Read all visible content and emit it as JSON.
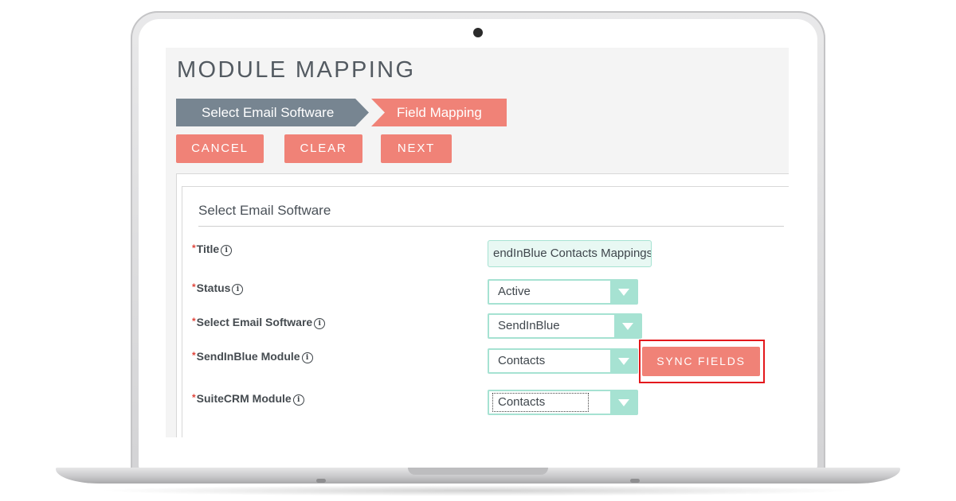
{
  "page": {
    "title": "MODULE MAPPING"
  },
  "wizard": {
    "steps": [
      {
        "label": "Select Email Software"
      },
      {
        "label": "Field Mapping"
      }
    ]
  },
  "actions": {
    "cancel": "CANCEL",
    "clear": "CLEAR",
    "next": "NEXT"
  },
  "form": {
    "heading": "Select Email Software",
    "required_marker": "*",
    "info_glyph": "i",
    "fields": {
      "title": {
        "label": "Title",
        "value": "endInBlue Contacts Mappings"
      },
      "status": {
        "label": "Status",
        "value": "Active"
      },
      "email_software": {
        "label": "Select Email Software",
        "value": "SendInBlue"
      },
      "sendinblue_module": {
        "label": "SendInBlue Module",
        "value": "Contacts"
      },
      "suitecrm_module": {
        "label": "SuiteCRM Module",
        "value": "Contacts"
      }
    },
    "sync_button": "SYNC FIELDS"
  },
  "colors": {
    "accent": "#f08277",
    "step_inactive": "#778591",
    "input_border": "#a6e2d2",
    "highlight": "#e4181c"
  },
  "icons": [
    "info-icon",
    "dropdown-arrow-icon",
    "camera-icon"
  ]
}
